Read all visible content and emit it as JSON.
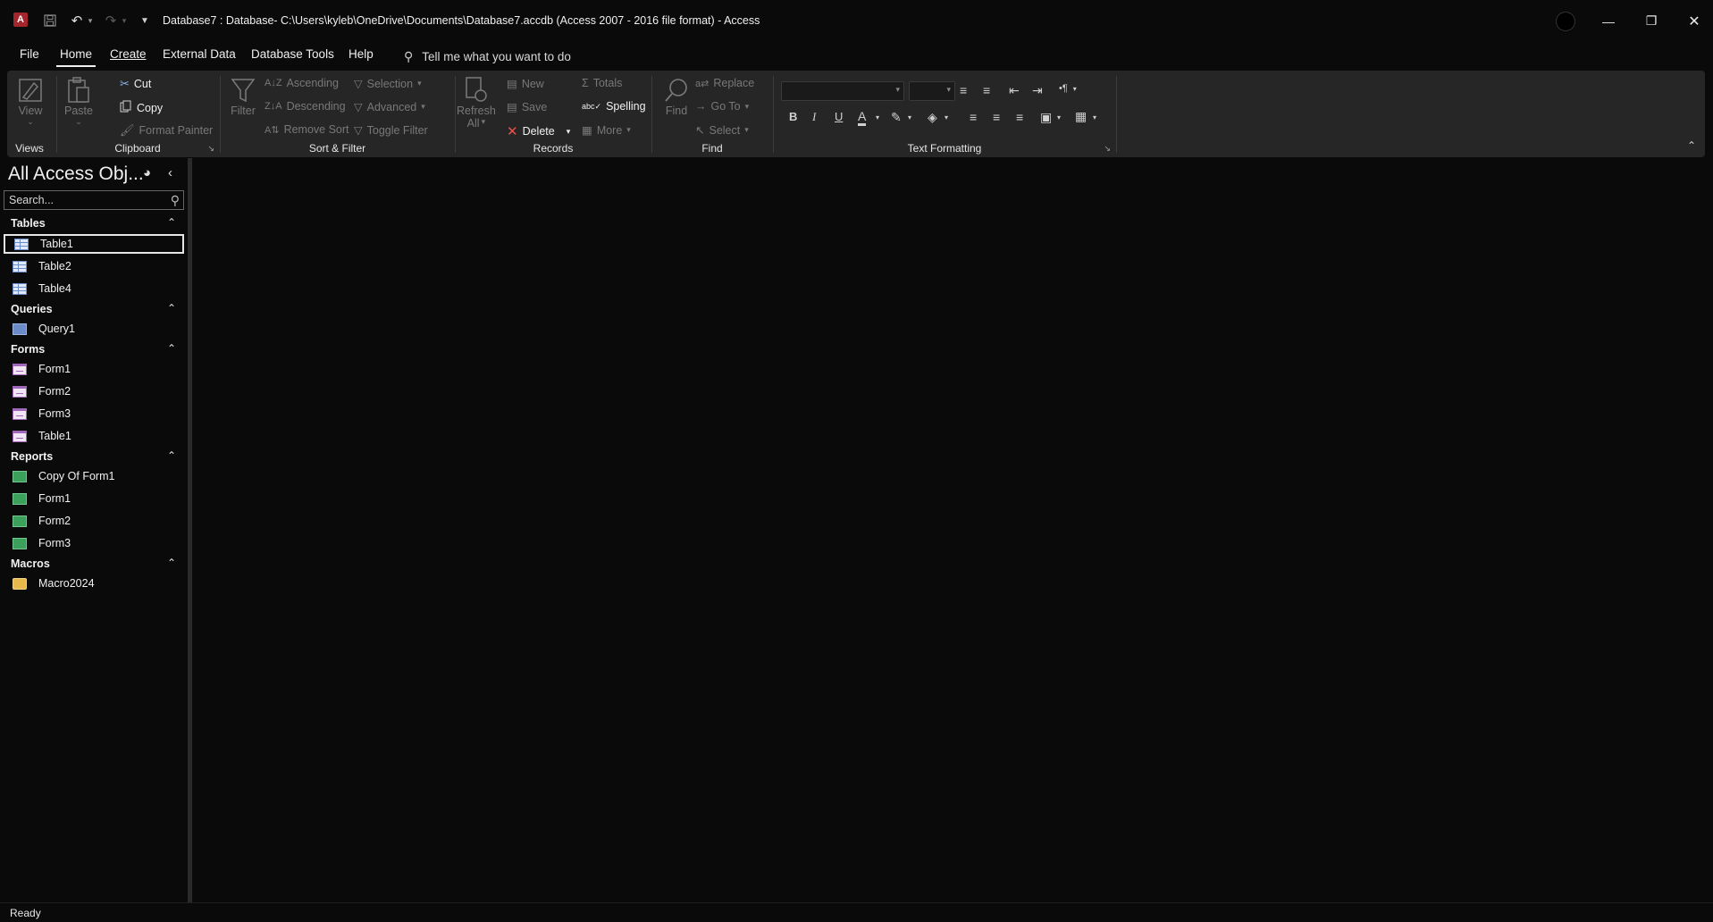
{
  "window": {
    "title": "Database7 : Database- C:\\Users\\kyleb\\OneDrive\\Documents\\Database7.accdb (Access 2007 - 2016 file format)  -  Access",
    "app_icon_letter": "A",
    "accent_color": "#a4262c"
  },
  "menu": {
    "tabs": [
      "File",
      "Home",
      "Create",
      "External Data",
      "Database Tools",
      "Help"
    ],
    "active_tab": "Home",
    "tell_me_placeholder": "Tell me what you want to do"
  },
  "ribbon": {
    "views": {
      "label": "Views",
      "view_btn": "View"
    },
    "clipboard": {
      "label": "Clipboard",
      "paste": "Paste",
      "cut": "Cut",
      "copy": "Copy",
      "format_painter": "Format Painter"
    },
    "sort_filter": {
      "label": "Sort & Filter",
      "filter": "Filter",
      "ascending": "Ascending",
      "descending": "Descending",
      "remove_sort": "Remove Sort",
      "selection": "Selection",
      "advanced": "Advanced",
      "toggle_filter": "Toggle Filter"
    },
    "records": {
      "label": "Records",
      "refresh": "Refresh",
      "refresh_all": "All",
      "new": "New",
      "save": "Save",
      "delete": "Delete",
      "totals": "Totals",
      "spelling": "Spelling",
      "more": "More"
    },
    "find": {
      "label": "Find",
      "find": "Find",
      "replace": "Replace",
      "goto": "Go To",
      "select": "Select"
    },
    "text_formatting": {
      "label": "Text Formatting",
      "bold": "B",
      "italic": "I",
      "underline": "U",
      "font_color": "A"
    }
  },
  "nav": {
    "title": "All Access Obj...",
    "search_placeholder": "Search...",
    "groups": {
      "tables": {
        "label": "Tables",
        "items": [
          "Table1",
          "Table2",
          "Table4"
        ]
      },
      "queries": {
        "label": "Queries",
        "items": [
          "Query1"
        ]
      },
      "forms": {
        "label": "Forms",
        "items": [
          "Form1",
          "Form2",
          "Form3",
          "Table1"
        ]
      },
      "reports": {
        "label": "Reports",
        "items": [
          "Copy Of Form1",
          "Form1",
          "Form2",
          "Form3"
        ]
      },
      "macros": {
        "label": "Macros",
        "items": [
          "Macro2024"
        ]
      }
    }
  },
  "status": {
    "text": "Ready"
  }
}
